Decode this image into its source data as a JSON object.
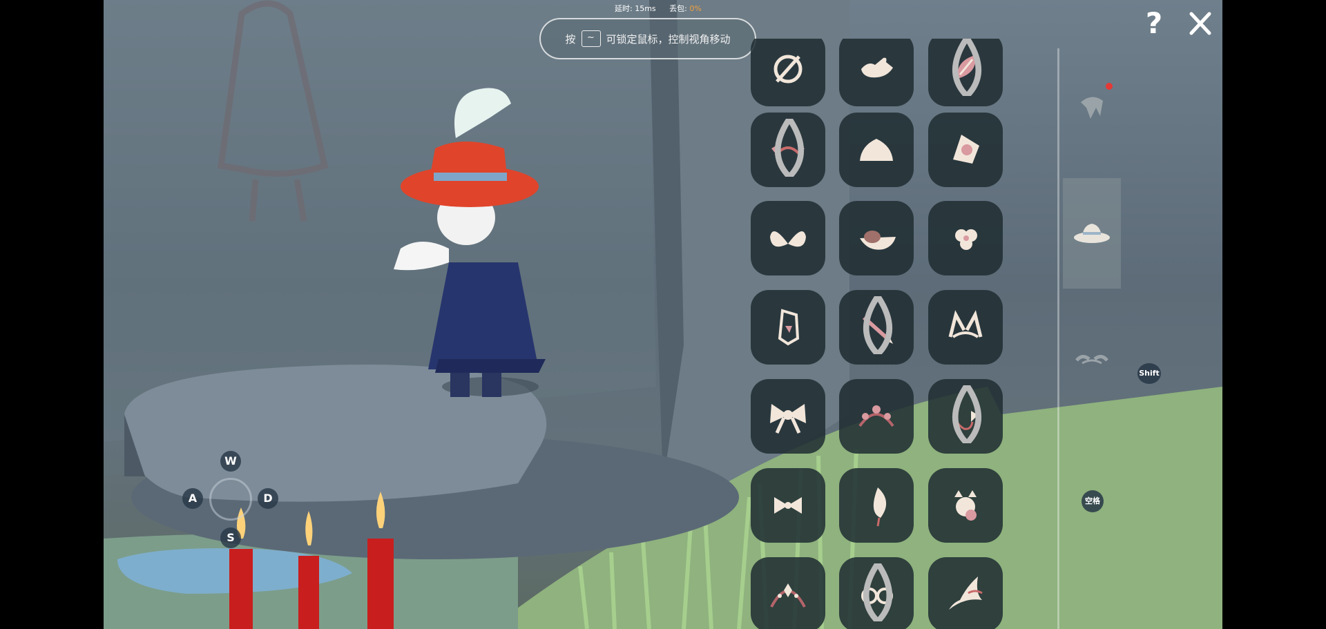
{
  "status": {
    "latency_label": "延时:",
    "latency_value": "15ms",
    "loss_label": "丢包:",
    "loss_value": "0%"
  },
  "hint": {
    "prefix": "按",
    "key": "~",
    "text": "可锁定鼠标，控制视角移动"
  },
  "controls": {
    "w": "W",
    "a": "A",
    "s": "S",
    "d": "D",
    "shift": "Shift",
    "space": "空格"
  },
  "top_buttons": {
    "help": "?"
  },
  "colors": {
    "cell_bg": "#202d32",
    "icon": "#f2e6da",
    "accent_red": "#e53935"
  },
  "items": [
    {
      "icon": "none-icon",
      "drop": false
    },
    {
      "icon": "bird-icon",
      "drop": false
    },
    {
      "icon": "leaf-clip-icon",
      "drop": true
    },
    {
      "icon": "ear-headband-icon",
      "drop": true
    },
    {
      "icon": "bun-hair-icon",
      "drop": false
    },
    {
      "icon": "flower-clip-icon",
      "drop": false
    },
    {
      "icon": "butterfly-icon",
      "drop": false
    },
    {
      "icon": "bowl-icon",
      "drop": false
    },
    {
      "icon": "small-flower-icon",
      "drop": false
    },
    {
      "icon": "crystal-icon",
      "drop": false
    },
    {
      "icon": "pencil-icon",
      "drop": true
    },
    {
      "icon": "cat-ears-icon",
      "drop": false
    },
    {
      "icon": "big-bow-icon",
      "drop": false
    },
    {
      "icon": "flower-crown-icon",
      "drop": false
    },
    {
      "icon": "hanging-ribbon-icon",
      "drop": true
    },
    {
      "icon": "small-bow-icon",
      "drop": false
    },
    {
      "icon": "feather-icon",
      "drop": false
    },
    {
      "icon": "flower-cat-icon",
      "drop": false
    },
    {
      "icon": "tiara-icon",
      "drop": false
    },
    {
      "icon": "goggles-icon",
      "drop": true
    },
    {
      "icon": "witch-hat-icon",
      "drop": false
    }
  ],
  "tabs": [
    {
      "icon": "hair-tab-icon",
      "selected": false,
      "badge": true
    },
    {
      "icon": "hat-tab-icon",
      "selected": true,
      "badge": false
    },
    {
      "icon": "horns-tab-icon",
      "selected": false,
      "badge": false
    }
  ]
}
